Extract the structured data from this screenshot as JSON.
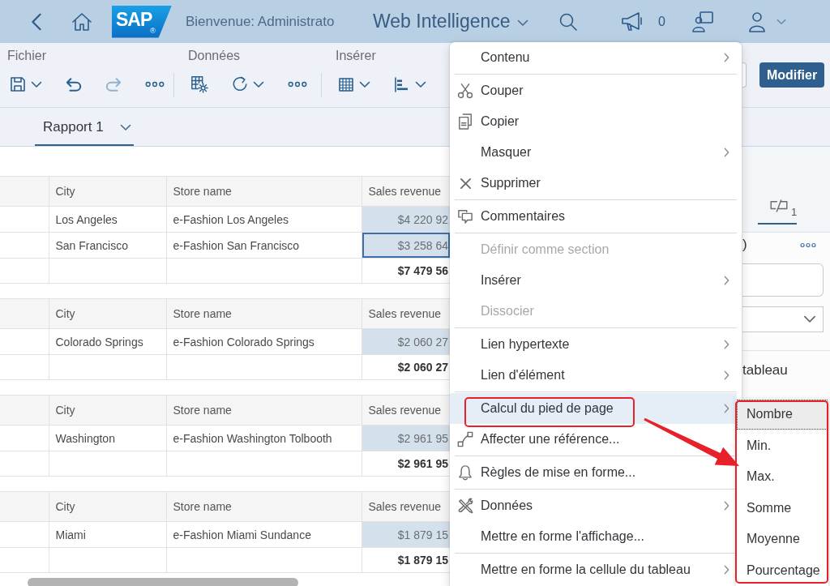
{
  "shell_bar": {
    "logo": "SAP",
    "logo_mark": "®",
    "welcome": "Bienvenue: Administrato",
    "app_title": "Web Intelligence",
    "notification_count": "0"
  },
  "toolbar": {
    "groups": [
      {
        "label": "Fichier",
        "tools": [
          {
            "dropdown": true,
            "disabled": false
          },
          {
            "dropdown": false,
            "disabled": false
          },
          {
            "dropdown": false,
            "disabled": true
          },
          {
            "dropdown": false,
            "disabled": false
          }
        ]
      },
      {
        "label": "Données",
        "tools": [
          {
            "dropdown": false,
            "disabled": false
          },
          {
            "dropdown": true,
            "disabled": false
          },
          {
            "dropdown": false,
            "disabled": false
          }
        ]
      },
      {
        "label": "Insérer",
        "tools": [
          {
            "dropdown": true,
            "disabled": false
          },
          {
            "dropdown": true,
            "disabled": false
          }
        ]
      }
    ],
    "edit_button": "Modifier"
  },
  "report_tabs": [
    {
      "label": "Rapport 1",
      "selected": true
    }
  ],
  "report": {
    "tables": [
      {
        "columns": [
          "City",
          "Store name",
          "Sales revenue"
        ],
        "rows": [
          {
            "city": "Los Angeles",
            "store_name": "e-Fashion Los Angeles",
            "sales_revenue": "$4 220 92",
            "selected": false
          },
          {
            "city": "San Francisco",
            "store_name": "e-Fashion San Francisco",
            "sales_revenue": "$3 258 64",
            "selected": true
          }
        ],
        "total": "$7 479 56"
      },
      {
        "columns": [
          "City",
          "Store name",
          "Sales revenue"
        ],
        "rows": [
          {
            "city": "Colorado Springs",
            "store_name": "e-Fashion Colorado Springs",
            "sales_revenue": "$2 060 27",
            "selected": false
          }
        ],
        "total": "$2 060 27"
      },
      {
        "columns": [
          "City",
          "Store name",
          "Sales revenue"
        ],
        "rows": [
          {
            "city": "Washington",
            "store_name": "e-Fashion Washington Tolbooth",
            "sales_revenue": "$2 961 95",
            "selected": false
          }
        ],
        "total": "$2 961 95"
      },
      {
        "columns": [
          "City",
          "Store name",
          "Sales revenue"
        ],
        "rows": [
          {
            "city": "Miami",
            "store_name": "e-Fashion Miami Sundance",
            "sales_revenue": "$1 879 15",
            "selected": false
          }
        ],
        "total": "$1 879 15"
      }
    ]
  },
  "side_panel": {
    "tabs": [
      {
        "count": "1",
        "selected": true
      }
    ],
    "heading": ")",
    "option_label": "tableau"
  },
  "context_menu": {
    "groups": [
      [
        {
          "label": "Contenu",
          "submenu": true,
          "disabled": false,
          "selected": false,
          "annotated": false
        }
      ],
      [
        {
          "label": "Couper",
          "submenu": false,
          "disabled": false,
          "selected": false,
          "annotated": false
        },
        {
          "label": "Copier",
          "submenu": false,
          "disabled": false,
          "selected": false,
          "annotated": false
        },
        {
          "label": "Masquer",
          "submenu": true,
          "disabled": false,
          "selected": false,
          "annotated": false
        },
        {
          "label": "Supprimer",
          "submenu": false,
          "disabled": false,
          "selected": false,
          "annotated": false
        }
      ],
      [
        {
          "label": "Commentaires",
          "submenu": false,
          "disabled": false,
          "selected": false,
          "annotated": false
        }
      ],
      [
        {
          "label": "Définir comme section",
          "submenu": false,
          "disabled": true,
          "selected": false,
          "annotated": false
        },
        {
          "label": "Insérer",
          "submenu": true,
          "disabled": false,
          "selected": false,
          "annotated": false
        },
        {
          "label": "Dissocier",
          "submenu": false,
          "disabled": true,
          "selected": false,
          "annotated": false
        }
      ],
      [
        {
          "label": "Lien hypertexte",
          "submenu": true,
          "disabled": false,
          "selected": false,
          "annotated": false
        },
        {
          "label": "Lien d'élément",
          "submenu": true,
          "disabled": false,
          "selected": false,
          "annotated": false
        }
      ],
      [
        {
          "label": "Calcul du pied de page",
          "submenu": true,
          "disabled": false,
          "selected": true,
          "annotated": true
        },
        {
          "label": "Affecter une référence...",
          "submenu": false,
          "disabled": false,
          "selected": false,
          "annotated": false
        }
      ],
      [
        {
          "label": "Règles de mise en forme...",
          "submenu": false,
          "disabled": false,
          "selected": false,
          "annotated": false
        }
      ],
      [
        {
          "label": "Données",
          "submenu": true,
          "disabled": false,
          "selected": false,
          "annotated": false
        },
        {
          "label": "Mettre en forme l'affichage...",
          "submenu": false,
          "disabled": false,
          "selected": false,
          "annotated": false
        }
      ],
      [
        {
          "label": "Mettre en forme la cellule du tableau",
          "submenu": true,
          "disabled": false,
          "selected": false,
          "annotated": false
        }
      ]
    ]
  },
  "submenu": {
    "annotated": true,
    "items": [
      {
        "label": "Nombre",
        "selected": true
      },
      {
        "label": "Min.",
        "selected": false
      },
      {
        "label": "Max.",
        "selected": false
      },
      {
        "label": "Somme",
        "selected": false
      },
      {
        "label": "Moyenne",
        "selected": false
      },
      {
        "label": "Pourcentage",
        "selected": false
      }
    ]
  },
  "annotation_arrow": true
}
